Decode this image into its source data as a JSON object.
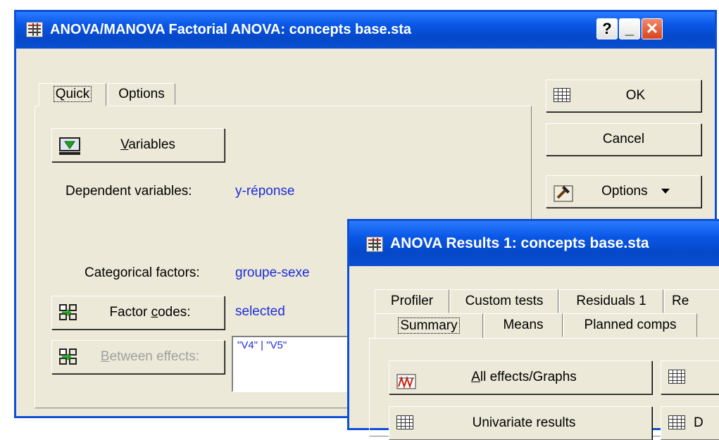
{
  "window1": {
    "title": "ANOVA/MANOVA Factorial ANOVA: concepts base.sta",
    "help": "?",
    "minimize": "_",
    "close": "✕",
    "tabs": [
      "Quick",
      "Options"
    ],
    "variables_label": [
      "",
      "V",
      "ariables"
    ],
    "dependent_label": "Dependent variables:",
    "dependent_value": "y-réponse",
    "categorical_label": "Categorical factors:",
    "categorical_value": "groupe-sexe",
    "factor_codes_label": [
      "Factor ",
      "c",
      "odes:"
    ],
    "factor_codes_value": "selected",
    "between_label": [
      "",
      "B",
      "etween effects:"
    ],
    "between_value": "\"V4\" | \"V5\"",
    "ok": "OK",
    "cancel": "Cancel",
    "options": "Options"
  },
  "window2": {
    "title": "ANOVA Results 1: concepts base.sta",
    "tabs_row1": [
      "Profiler",
      "Custom tests",
      "Residuals 1",
      "Re"
    ],
    "tabs_row2": [
      "Summary",
      "Means",
      "Planned comps"
    ],
    "all_effects": [
      "",
      "A",
      "ll effects/Graphs"
    ],
    "univariate": "Univariate results",
    "right_btn2": "D"
  },
  "colors": {
    "titlebar": "#0a57e6",
    "window_bg": "#ece9d8",
    "value_text": "#1c2cd8"
  }
}
